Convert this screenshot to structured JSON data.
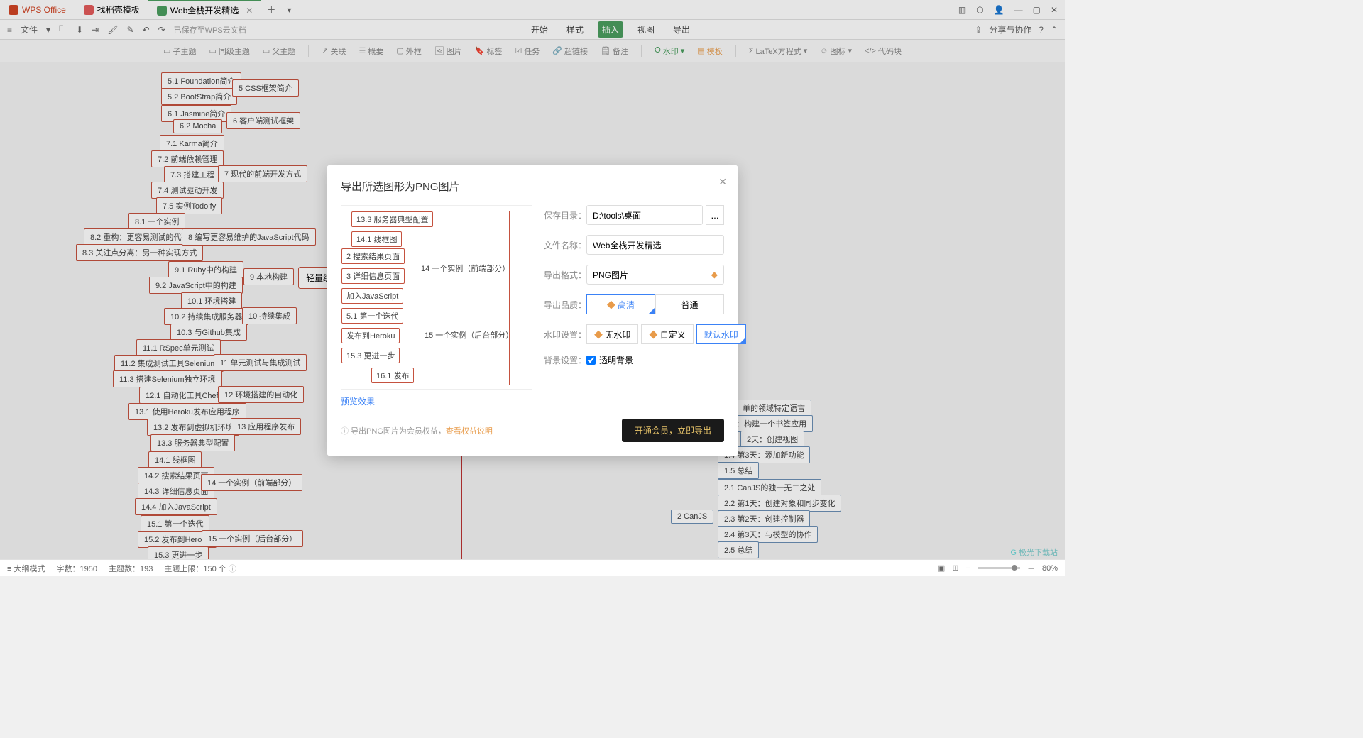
{
  "titlebar": {
    "app": "WPS Office",
    "tab1": "找稻壳模板",
    "tab2": "Web全栈开发精选",
    "win": {
      "min": "—",
      "max": "▢",
      "close": "✕"
    }
  },
  "menubar": {
    "file": "文件",
    "saved": "已保存至WPS云文档",
    "menus": [
      "开始",
      "样式",
      "插入",
      "视图",
      "导出"
    ],
    "share": "分享与协作"
  },
  "toolbar": {
    "items": [
      "子主题",
      "同级主题",
      "父主题",
      "关联",
      "概要",
      "外框",
      "图片",
      "标签",
      "任务",
      "超链接",
      "备注",
      "水印",
      "模板",
      "LaTeX方程式",
      "图标",
      "代码块"
    ]
  },
  "dialog": {
    "title": "导出所选图形为PNG图片",
    "saveDir": {
      "label": "保存目录：",
      "value": "D:\\tools\\桌面",
      "more": "..."
    },
    "fileName": {
      "label": "文件名称：",
      "value": "Web全栈开发精选"
    },
    "format": {
      "label": "导出格式：",
      "value": "PNG图片"
    },
    "quality": {
      "label": "导出品质：",
      "hd": "高清",
      "normal": "普通"
    },
    "watermark": {
      "label": "水印设置：",
      "none": "无水印",
      "custom": "自定义",
      "default": "默认水印"
    },
    "background": {
      "label": "背景设置：",
      "transparent": "透明背景"
    },
    "previewLink": "预览效果",
    "footer": {
      "tip": "导出PNG图片为会员权益，",
      "link": "查看权益说明",
      "btn": "开通会员，立即导出"
    },
    "preview": {
      "n1": "13.3 服务器典型配置",
      "n2": "14.1 线框图",
      "n3": "2 搜索结果页面",
      "n4": "3 详细信息页面",
      "n5": "加入JavaScript",
      "n6": "5.1 第一个迭代",
      "n7": "发布到Heroku",
      "n8": "15.3 更进一步",
      "n9": "16.1 发布",
      "g14": "14 一个实例（前端部分）",
      "g15": "15 一个实例（后台部分）"
    }
  },
  "nodes": {
    "n51": "5.1 Foundation简介",
    "n52": "5.2 BootStrap简介",
    "g5": "5 CSS框架简介",
    "n61": "6.1 Jasmine简介",
    "n62": "6.2 Mocha",
    "g6": "6 客户端测试框架",
    "n71": "7.1 Karma简介",
    "n72": "7.2 前端依赖管理",
    "n73": "7.3 搭建工程",
    "n74": "7.4 测试驱动开发",
    "n75": "7.5 实例Todoify",
    "g7": "7 现代的前端开发方式",
    "n81": "8.1 一个实例",
    "n82": "8.2 重构：更容易测试的代码",
    "n83": "8.3 关注点分离：另一种实现方式",
    "g8": "8 编写更容易维护的JavaScript代码",
    "n91": "9.1 Ruby中的构建",
    "n92": "9.2 JavaScript中的构建",
    "g9": "9 本地构建",
    "root": "轻量级W",
    "n101": "10.1 环境搭建",
    "n102": "10.2 持续集成服务器",
    "n103": "10.3 与Github集成",
    "g10": "10 持续集成",
    "n111": "11.1 RSpec单元测试",
    "n112": "11.2 集成测试工具Selenium",
    "n113": "11.3 搭建Selenium独立环境",
    "g11": "11 单元测试与集成测试",
    "n121": "12.1 自动化工具Chef",
    "g12": "12 环境搭建的自动化",
    "n131": "13.1 使用Heroku发布应用程序",
    "n132": "13.2 发布到虚拟机环境",
    "n133": "13.3 服务器典型配置",
    "g13": "13 应用程序发布",
    "n141": "14.1 线框图",
    "n142": "14.2 搜索结果页面",
    "n143": "14.3 详细信息页面",
    "n144": "14.4 加入JavaScript",
    "g14": "14 一个实例（前端部分）",
    "n151": "15.1 第一个迭代",
    "n152": "15.2 发布到Heroku",
    "n153": "15.3 更进一步",
    "g15": "15 一个实例（后台部分）",
    "r1": "单的领域特定语言",
    "r2": "1天：构建一个书签应用",
    "r3": "2天：创建视图",
    "r4": "1.4 第3天：添加新功能",
    "r5": "1.5 总结",
    "r6": "2.1 CanJS的独一无二之处",
    "r7": "2.2 第1天：创建对象和同步变化",
    "r8": "2.3 第2天：创建控制器",
    "r9": "2.4 第3天：与模型的协作",
    "r10": "2.5 总结",
    "rg2": "2 CanJS"
  },
  "statusbar": {
    "outline": "大纲模式",
    "words": "字数：1950",
    "topics": "主题数：193",
    "limit": "主题上限：150 个",
    "zoom": "80%"
  },
  "watermark": "极光下载站"
}
